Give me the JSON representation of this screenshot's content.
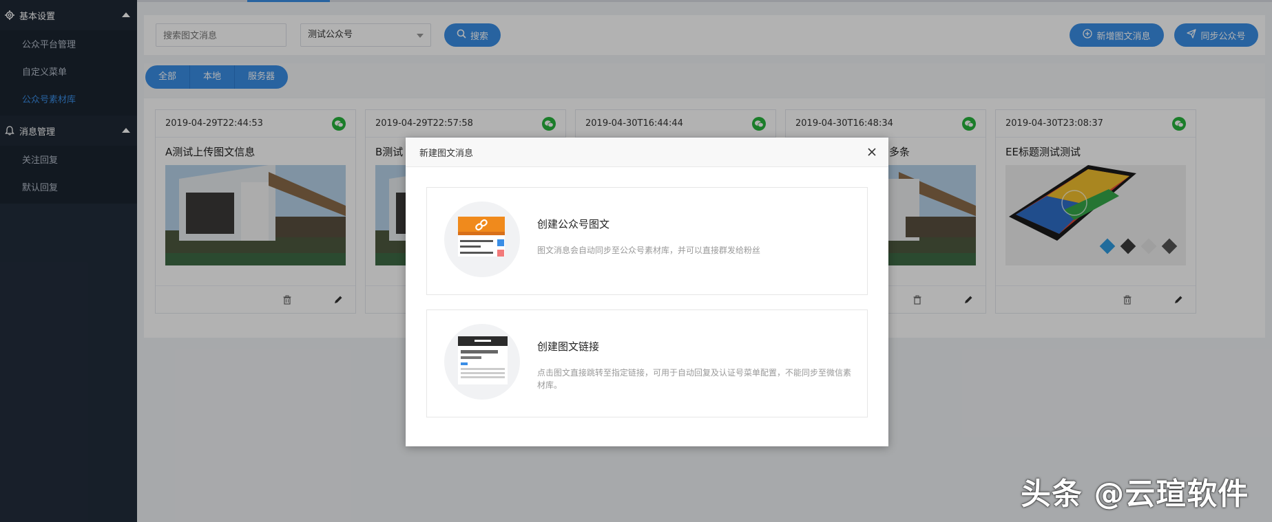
{
  "sidebar": {
    "groups": [
      {
        "title": "基本设置",
        "icon": "gear-icon",
        "items": [
          "公众平台管理",
          "自定义菜单",
          "公众号素材库"
        ],
        "active_index": 2
      },
      {
        "title": "消息管理",
        "icon": "bell-icon",
        "items": [
          "关注回复",
          "默认回复"
        ]
      }
    ]
  },
  "toolbar": {
    "search_placeholder": "搜索图文消息",
    "account_select": "测试公众号",
    "search_button": "搜索",
    "new_button": "新增图文消息",
    "sync_button": "同步公众号"
  },
  "filter": {
    "tabs": [
      "全部",
      "本地",
      "服务器"
    ]
  },
  "cards": [
    {
      "date": "2019-04-29T22:44:53",
      "title": "A测试上传图文信息",
      "image": "house"
    },
    {
      "date": "2019-04-29T22:57:58",
      "title": "B测试",
      "image": "house"
    },
    {
      "date": "2019-04-30T16:44:44",
      "title": "",
      "image": "house"
    },
    {
      "date": "2019-04-30T16:48:34",
      "title": "多条",
      "image": "house"
    },
    {
      "date": "2019-04-30T23:08:37",
      "title": "EE标题测试测试",
      "image": "phone"
    }
  ],
  "modal": {
    "title": "新建图文消息",
    "options": [
      {
        "title": "创建公众号图文",
        "desc": "图文消息会自动同步至公众号素材库，并可以直接群发给粉丝",
        "icon": "article-icon"
      },
      {
        "title": "创建图文链接",
        "desc": "点击图文直接跳转至指定链接，可用于自动回复及认证号菜单配置，不能同步至微信素材库。",
        "icon": "link-page-icon"
      }
    ]
  },
  "watermark": "头条 @云瑄软件",
  "colors": {
    "accent": "#3a8ee6",
    "sidebar_bg": "#222d3c",
    "wechat_green": "#27b33d",
    "orange": "#f08a1c"
  }
}
